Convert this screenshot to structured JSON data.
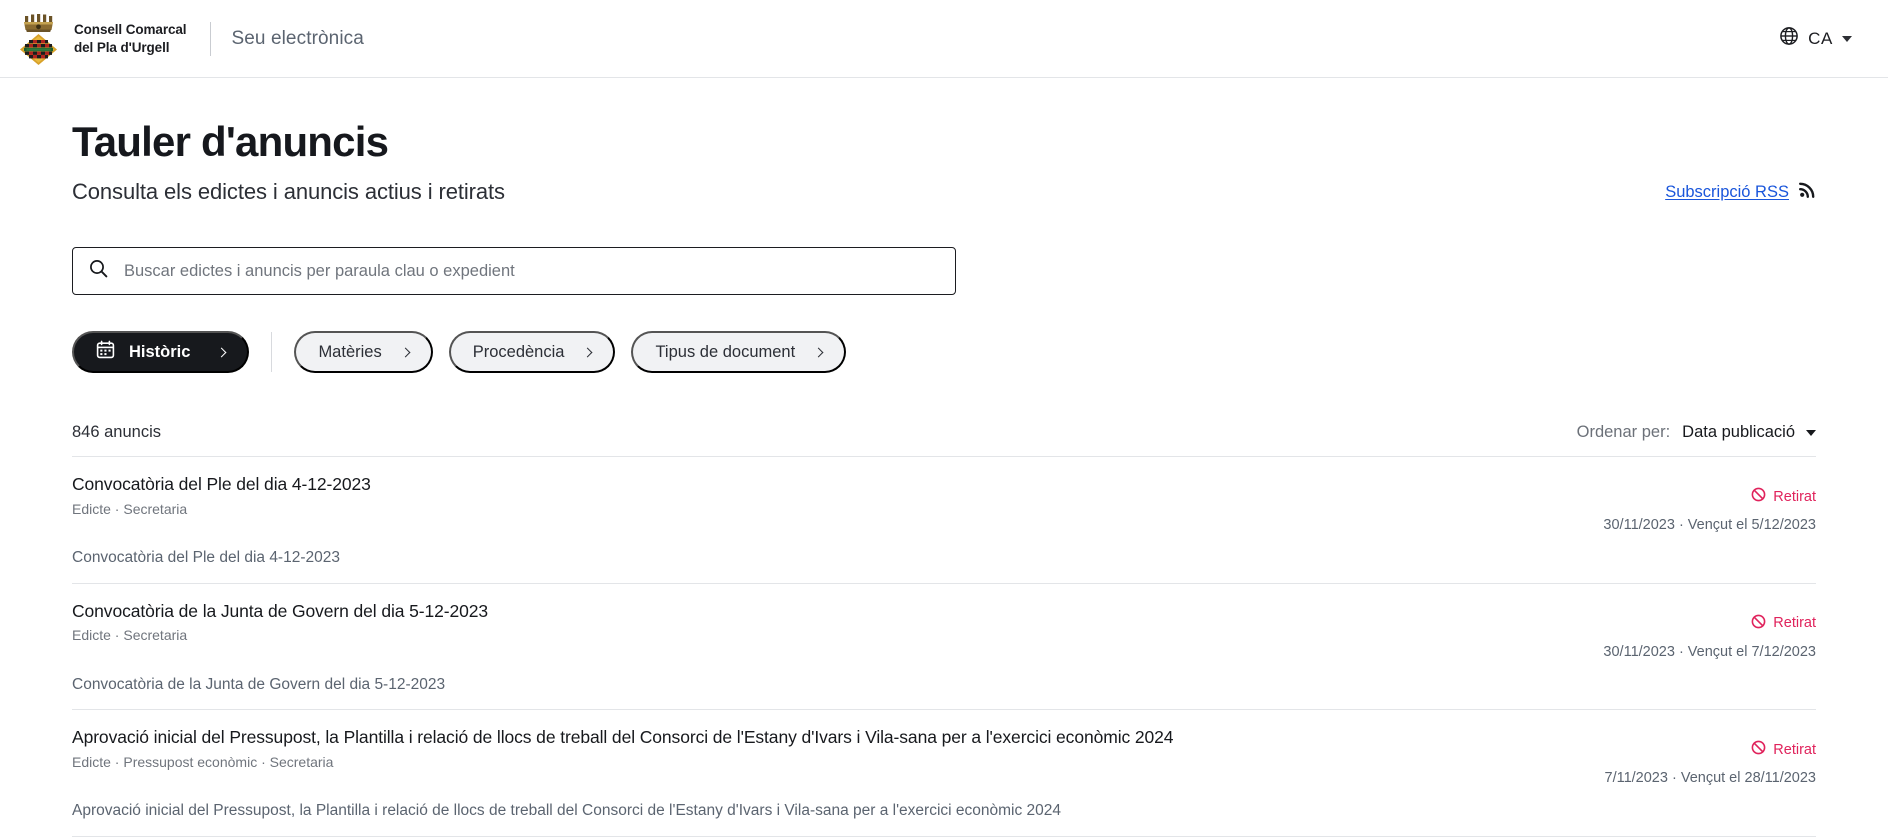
{
  "header": {
    "brand_line1": "Consell Comarcal",
    "brand_line2": "del Pla d'Urgell",
    "sede_label": "Seu electrònica",
    "language_code": "CA",
    "globe_icon": "globe-icon",
    "caret_icon": "chevron-down-icon"
  },
  "page": {
    "title": "Tauler d'anuncis",
    "subtitle": "Consulta els edictes i anuncis actius i retirats",
    "rss_label": "Subscripció RSS",
    "rss_icon": "rss-icon"
  },
  "search": {
    "placeholder": "Buscar edictes i anuncis per paraula clau o expedient",
    "value": "",
    "icon": "search-icon"
  },
  "filters": {
    "primary": {
      "label": "Històric",
      "icon": "calendar-icon",
      "chevron": "chevron-right-icon"
    },
    "items": [
      {
        "label": "Matèries",
        "chevron": "chevron-right-icon"
      },
      {
        "label": "Procedència",
        "chevron": "chevron-right-icon"
      },
      {
        "label": "Tipus de document",
        "chevron": "chevron-right-icon"
      }
    ]
  },
  "results": {
    "count_label": "846 anuncis",
    "sort_prefix": "Ordenar per:",
    "sort_value": "Data publicació",
    "sort_caret": "chevron-down-icon",
    "items": [
      {
        "title": "Convocatòria del Ple del dia 4-12-2023",
        "tags": "Edicte · Secretaria",
        "status": "Retirat",
        "status_icon": "blocked-icon",
        "dates": "30/11/2023 · Vençut el 5/12/2023",
        "description": "Convocatòria del Ple del dia 4-12-2023"
      },
      {
        "title": "Convocatòria de la Junta de Govern del dia 5-12-2023",
        "tags": "Edicte · Secretaria",
        "status": "Retirat",
        "status_icon": "blocked-icon",
        "dates": "30/11/2023 · Vençut el 7/12/2023",
        "description": "Convocatòria de la Junta de Govern del dia 5-12-2023"
      },
      {
        "title": "Aprovació inicial del Pressupost, la Plantilla i relació de llocs de treball del Consorci de l'Estany d'Ivars i Vila-sana per a l'exercici econòmic 2024",
        "tags": "Edicte · Pressupost econòmic · Secretaria",
        "status": "Retirat",
        "status_icon": "blocked-icon",
        "dates": "7/11/2023 · Vençut el 28/11/2023",
        "description": "Aprovació inicial del Pressupost, la Plantilla i relació de llocs de treball del Consorci de l'Estany d'Ivars i Vila-sana per a l'exercici econòmic 2024"
      }
    ]
  },
  "colors": {
    "accent_link": "#1a56db",
    "status_retirat": "#e0235c",
    "pill_dark": "#17191d",
    "pill_ghost": "#f1f2f4"
  }
}
